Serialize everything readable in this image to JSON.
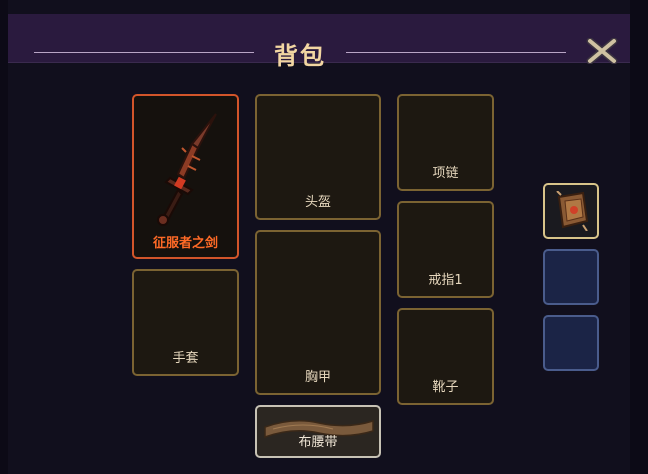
{
  "window": {
    "title": "背包",
    "close_icon": "close-x-icon"
  },
  "equipment_slots": {
    "weapon": {
      "label": "征服者之剑",
      "item_icon": "sword-icon"
    },
    "helmet": {
      "label": "头盔"
    },
    "necklace": {
      "label": "项链"
    },
    "ring": {
      "label": "戒指1"
    },
    "gloves": {
      "label": "手套"
    },
    "chest": {
      "label": "胸甲"
    },
    "boots": {
      "label": "靴子"
    },
    "belt": {
      "label": "布腰带",
      "item_icon": "cloth-belt-icon"
    }
  },
  "side_slots": [
    {
      "name": "scroll",
      "item_icon": "scroll-icon"
    },
    {
      "name": "empty-1"
    },
    {
      "name": "empty-2"
    }
  ],
  "colors": {
    "title": "#f2d6a2",
    "slot_border": "#7b6332",
    "weapon_border": "#d2552a",
    "weapon_label": "#ff6a26",
    "side_slot": "#1b2446"
  }
}
